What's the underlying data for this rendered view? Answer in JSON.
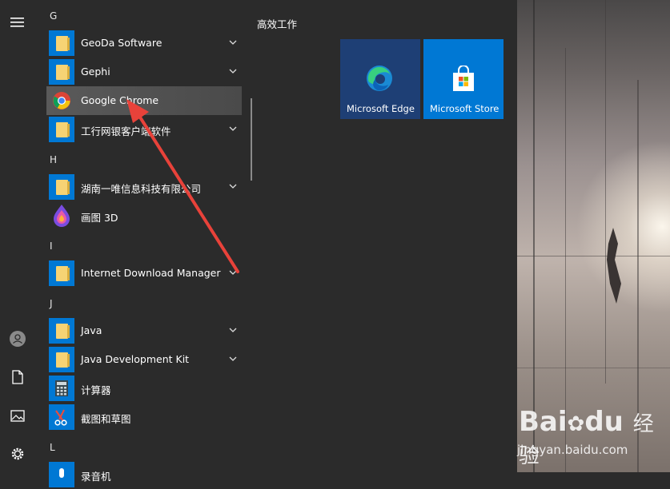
{
  "rail": {
    "items": [
      "menu-icon",
      "user-icon",
      "document-icon",
      "pictures-icon",
      "settings-icon"
    ]
  },
  "list": {
    "sections": [
      {
        "letter": "G"
      },
      {
        "letter": "H"
      },
      {
        "letter": "I"
      },
      {
        "letter": "J"
      },
      {
        "letter": "L"
      }
    ],
    "apps": [
      {
        "label": "GeoDa Software"
      },
      {
        "label": "Gephi"
      },
      {
        "label": "Google Chrome"
      },
      {
        "label": "工行网银客户端软件"
      },
      {
        "label": "湖南一唯信息科技有限公司"
      },
      {
        "label": "画图 3D"
      },
      {
        "label": "Internet Download Manager"
      },
      {
        "label": "Java"
      },
      {
        "label": "Java Development Kit"
      },
      {
        "label": "计算器"
      },
      {
        "label": "截图和草图"
      },
      {
        "label": "录音机"
      }
    ]
  },
  "tiles": {
    "group_title": "高效工作",
    "items": [
      {
        "label": "Microsoft Edge",
        "color": "#1e3f75"
      },
      {
        "label": "Microsoft Store",
        "color": "#0078d4"
      }
    ]
  },
  "watermark": {
    "brand": "Bai",
    "brand2": "du",
    "jingyan": "经验",
    "url": "jingyan.baidu.com"
  },
  "colors": {
    "accent": "#0078d4",
    "highlight": "#555555",
    "arrow": "#e8423a"
  }
}
